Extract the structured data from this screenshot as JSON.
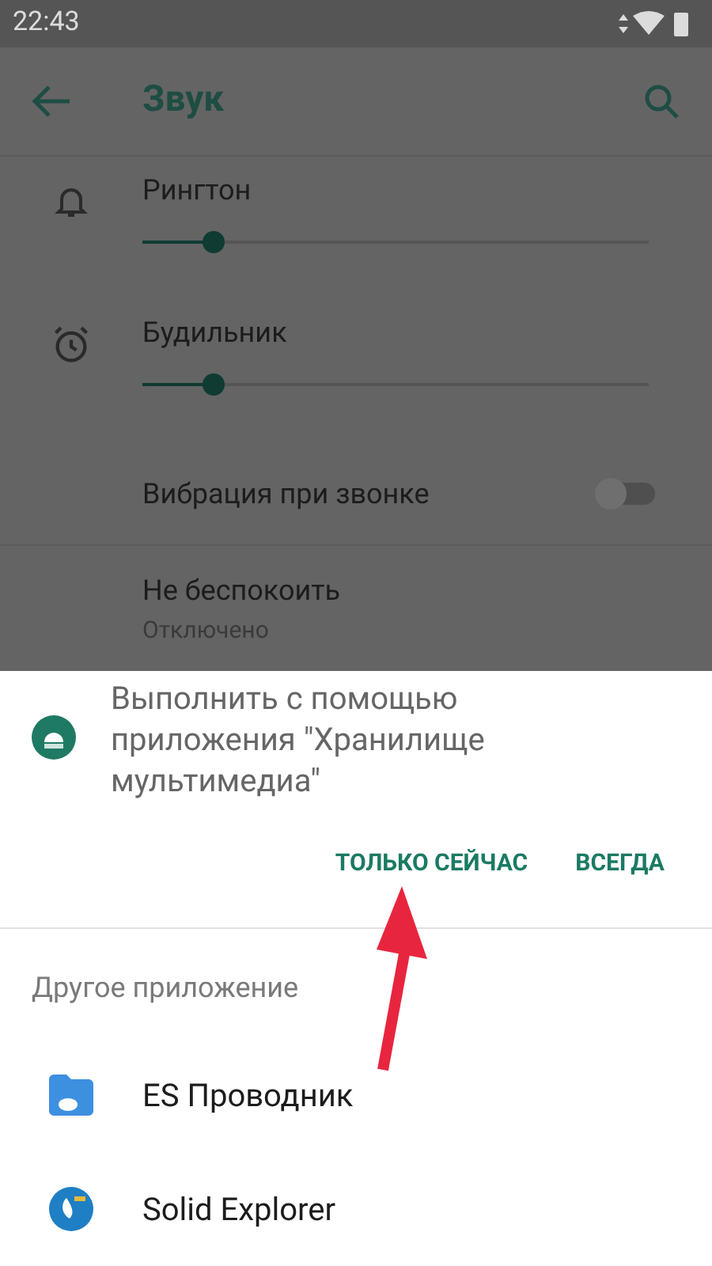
{
  "status_bar": {
    "time": "22:43"
  },
  "toolbar": {
    "title": "Звук"
  },
  "settings": [
    {
      "kind": "slider",
      "title": "Рингтон",
      "level": 0.14
    },
    {
      "kind": "slider",
      "title": "Будильник",
      "level": 0.14
    },
    {
      "kind": "switch",
      "title": "Вибрация при звонке",
      "on": false
    },
    {
      "kind": "text",
      "title": "Не беспокоить",
      "subtitle": "Отключено"
    }
  ],
  "sheet": {
    "message": "Выполнить с помощью приложения \"Хранилище мультимедиа\"",
    "buttons": [
      "ТОЛЬКО СЕЙЧАС",
      "ВСЕГДА"
    ],
    "other_header": "Другое приложение",
    "apps": [
      {
        "name": "ES Проводник"
      },
      {
        "name": "Solid Explorer"
      }
    ]
  }
}
